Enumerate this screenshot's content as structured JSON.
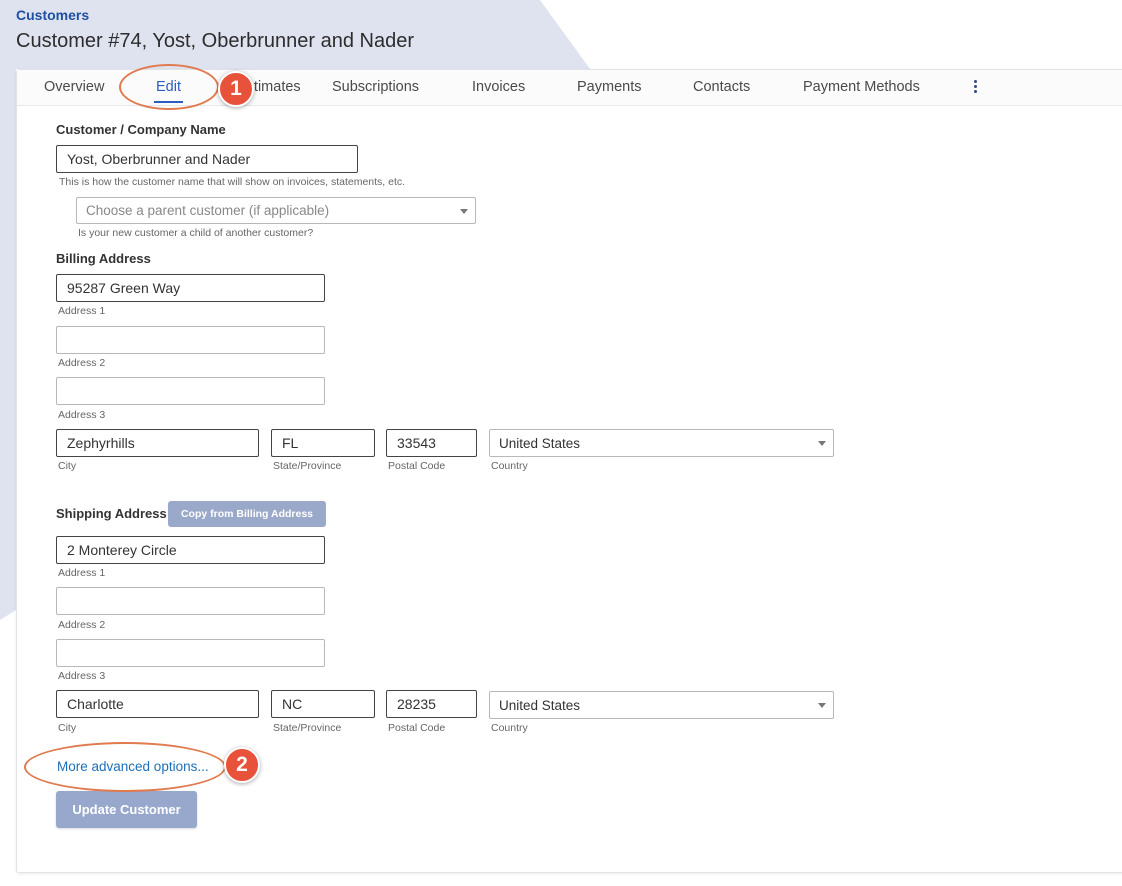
{
  "header": {
    "breadcrumb": "Customers",
    "title": "Customer #74, Yost, Oberbrunner and Nader"
  },
  "tabs": [
    {
      "label": "Overview",
      "active": false
    },
    {
      "label": "Edit",
      "active": true
    },
    {
      "label": "Estimates",
      "active": false
    },
    {
      "label": "Subscriptions",
      "active": false
    },
    {
      "label": "Invoices",
      "active": false
    },
    {
      "label": "Payments",
      "active": false
    },
    {
      "label": "Contacts",
      "active": false
    },
    {
      "label": "Payment Methods",
      "active": false
    }
  ],
  "form": {
    "name_label": "Customer / Company Name",
    "name_value": "Yost, Oberbrunner and Nader",
    "name_help": "This is how the customer name that will show on invoices, statements, etc.",
    "parent_placeholder": "Choose a parent customer (if applicable)",
    "parent_help": "Is your new customer a child of another customer?",
    "billing": {
      "label": "Billing Address",
      "address1": "95287 Green Way",
      "address2": "",
      "address3": "",
      "city": "Zephyrhills",
      "state": "FL",
      "postal": "33543",
      "country": "United States"
    },
    "shipping": {
      "label": "Shipping Address",
      "copy_button": "Copy from Billing Address",
      "address1": "2 Monterey Circle",
      "address2": "",
      "address3": "",
      "city": "Charlotte",
      "state": "NC",
      "postal": "28235",
      "country": "United States"
    },
    "field_labels": {
      "address1": "Address 1",
      "address2": "Address 2",
      "address3": "Address 3",
      "city": "City",
      "state": "State/Province",
      "postal": "Postal Code",
      "country": "Country"
    },
    "advanced_link": "More advanced options...",
    "submit_button": "Update Customer"
  },
  "annotations": {
    "badge1": "1",
    "badge2": "2",
    "color": "#e8513a"
  }
}
